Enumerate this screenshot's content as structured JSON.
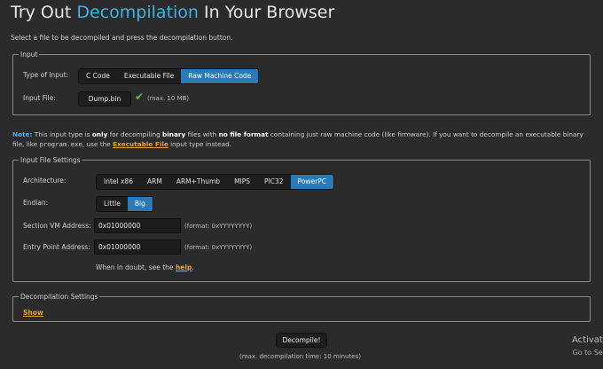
{
  "header": {
    "title_prefix": "Try Out ",
    "title_highlight": "Decompilation",
    "title_suffix": " In Your Browser",
    "subtitle": "Select a file to be decompiled and press the decompilation button."
  },
  "input_section": {
    "legend": "Input",
    "type_label": "Type of Input:",
    "types": [
      "C Code",
      "Executable File",
      "Raw Machine Code"
    ],
    "selected_type": "Raw Machine Code",
    "file_label": "Input File:",
    "file_button": "Dump.bin",
    "file_max": "(max. 10 MB)"
  },
  "note": {
    "label": "Note:",
    "t1": " This input type is ",
    "b1": "only",
    "t2": " for decompiling ",
    "b2": "binary",
    "t3": " files with ",
    "b3": "no file format",
    "t4": " containing just raw machine code (like firmware). If you want to decompile an executable binary file, like ",
    "mono": "program.exe",
    "t5": ", use the ",
    "link": "Executable File",
    "t6": " input type instead."
  },
  "file_settings": {
    "legend": "Input File Settings",
    "arch_label": "Architecture:",
    "architectures": [
      "Intel x86",
      "ARM",
      "ARM+Thumb",
      "MIPS",
      "PIC32",
      "PowerPC"
    ],
    "selected_arch": "PowerPC",
    "endian_label": "Endian:",
    "endians": [
      "Little",
      "Big"
    ],
    "selected_endian": "Big",
    "section_vm_label": "Section VM Address:",
    "section_vm_value": "0x01000000",
    "section_vm_format": "(format: 0xYYYYYYYY)",
    "entry_label": "Entry Point Address:",
    "entry_value": "0x01000000",
    "entry_format": "(format: 0xYYYYYYYY)",
    "doubt_text": "When in doubt, see the ",
    "doubt_link": "help",
    "doubt_end": "."
  },
  "decomp_settings": {
    "legend": "Decompilation Settings",
    "show_link": "Show"
  },
  "footer": {
    "decompile_button": "Decompile!",
    "max_time": "(max. decompilation time: 10 minutes)"
  },
  "watermark": {
    "line1": "Activate",
    "line2": "Go to Sett"
  },
  "colors": {
    "accent": "#3fb3e6",
    "selected": "#2a7ab8",
    "link": "#e0a52a",
    "check": "#56c23c"
  }
}
